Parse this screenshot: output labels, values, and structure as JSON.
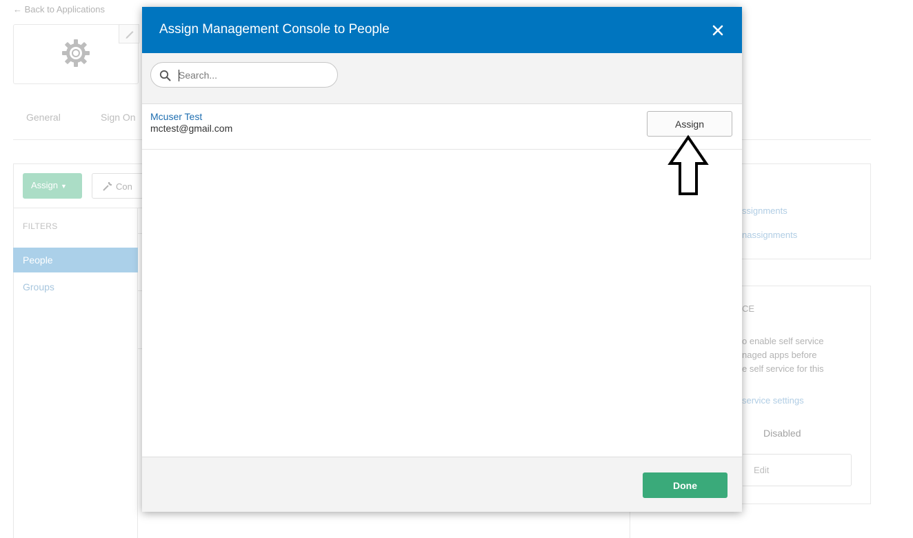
{
  "background": {
    "back_link": "← Back to Applications",
    "tabs": [
      "General",
      "Sign On"
    ],
    "toolbar": {
      "assign_label": "Assign",
      "convert_label": "Con"
    },
    "filters": {
      "heading": "FILTERS",
      "items": [
        "People",
        "Groups"
      ]
    },
    "side_panel": {
      "link_1": "ssignments",
      "link_2": "nassignments",
      "section_title": "CE",
      "text_lines": [
        "o enable self service",
        "naged apps before",
        "e self service for this"
      ],
      "settings_link": "service settings",
      "status": "Disabled",
      "edit_label": "Edit"
    }
  },
  "modal": {
    "title": "Assign Management Console to People",
    "search": {
      "placeholder": "Search..."
    },
    "results": [
      {
        "name": "Mcuser Test",
        "email": "mctest@gmail.com",
        "action_label": "Assign"
      }
    ],
    "done_label": "Done"
  },
  "colors": {
    "header_blue": "#0075bf",
    "done_green": "#3aaa7a",
    "link_blue": "#1e6eb0",
    "selected_filter": "#7fb7de"
  }
}
